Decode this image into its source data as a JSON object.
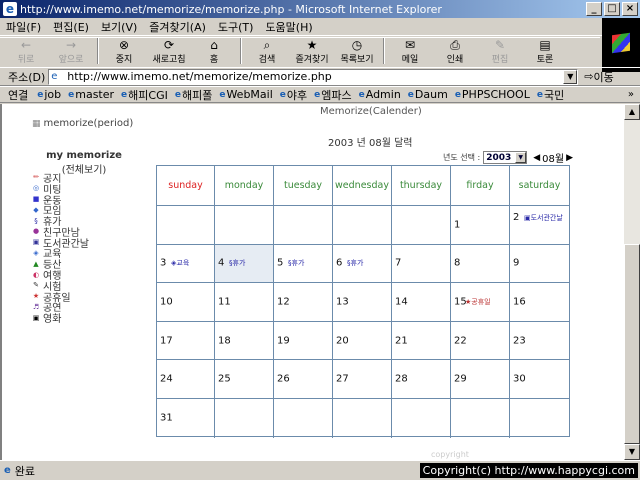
{
  "window": {
    "title": "http://www.imemo.net/memorize/memorize.php - Microsoft Internet Explorer",
    "controls": {
      "minimize": "_",
      "maximize": "□",
      "close": "×"
    }
  },
  "menu": [
    "파일(F)",
    "편집(E)",
    "보기(V)",
    "즐겨찾기(A)",
    "도구(T)",
    "도움말(H)"
  ],
  "toolbar": [
    {
      "label": "뒤로",
      "icon": "←",
      "disabled": true
    },
    {
      "label": "앞으로",
      "icon": "→",
      "disabled": true
    },
    {
      "label": "중지",
      "icon": "⊗",
      "disabled": false
    },
    {
      "label": "새로고침",
      "icon": "⟳",
      "disabled": false
    },
    {
      "label": "홈",
      "icon": "⌂",
      "disabled": false
    },
    {
      "label": "검색",
      "icon": "⌕",
      "disabled": false
    },
    {
      "label": "즐겨찾기",
      "icon": "★",
      "disabled": false
    },
    {
      "label": "목록보기",
      "icon": "◷",
      "disabled": false
    },
    {
      "label": "메일",
      "icon": "✉",
      "disabled": false
    },
    {
      "label": "인쇄",
      "icon": "⎙",
      "disabled": false
    },
    {
      "label": "편집",
      "icon": "✎",
      "disabled": true
    },
    {
      "label": "토론",
      "icon": "▤",
      "disabled": false
    }
  ],
  "address": {
    "label": "주소(D)",
    "value": "http://www.imemo.net/memorize/memorize.php",
    "go": "이동"
  },
  "links": {
    "label": "연결",
    "items": [
      "job",
      "master",
      "해피CGI",
      "해피폴",
      "WebMail",
      "야후",
      "엠파스",
      "Admin",
      "Daum",
      "PHPSCHOOL",
      "국민"
    ],
    "more": "»"
  },
  "sidebar": {
    "header": "memorize(period)",
    "title": "my memorize",
    "view_all": "(전체보기)",
    "categories": [
      {
        "label": "공지",
        "icon": "✏",
        "color": "#cc3333"
      },
      {
        "label": "미팅",
        "icon": "◎",
        "color": "#3366cc"
      },
      {
        "label": "운동",
        "icon": "■",
        "color": "#3333cc"
      },
      {
        "label": "모임",
        "icon": "◆",
        "color": "#3366cc"
      },
      {
        "label": "휴가",
        "icon": "§",
        "color": "#3333aa"
      },
      {
        "label": "친구만남",
        "icon": "●",
        "color": "#993399"
      },
      {
        "label": "도서관간날",
        "icon": "▣",
        "color": "#333399"
      },
      {
        "label": "교육",
        "icon": "◈",
        "color": "#3366cc"
      },
      {
        "label": "등산",
        "icon": "▲",
        "color": "#228822"
      },
      {
        "label": "여행",
        "icon": "◐",
        "color": "#cc3366"
      },
      {
        "label": "시험",
        "icon": "✎",
        "color": "#333333"
      },
      {
        "label": "공휴일",
        "icon": "★",
        "color": "#cc3333"
      },
      {
        "label": "공연",
        "icon": "♬",
        "color": "#663399"
      },
      {
        "label": "영화",
        "icon": "▣",
        "color": "#000000"
      }
    ]
  },
  "calendar": {
    "page_header": "Memorize(Calender)",
    "title": "2003 년 08월 달력",
    "year_label": "년도 선택 :",
    "year": "2003",
    "month": "08월",
    "prev": "◀",
    "next": "▶",
    "weekdays": [
      "sunday",
      "monday",
      "tuesday",
      "wednesday",
      "thursday",
      "firday",
      "saturday"
    ],
    "weeks": [
      [
        {
          "d": ""
        },
        {
          "d": ""
        },
        {
          "d": ""
        },
        {
          "d": ""
        },
        {
          "d": ""
        },
        {
          "d": "1"
        },
        {
          "d": "2",
          "ev": "▣도서관간날",
          "wrap": true
        }
      ],
      [
        {
          "d": "3",
          "ev": "◈교육"
        },
        {
          "d": "4",
          "ev": "§휴가",
          "hl": true
        },
        {
          "d": "5",
          "ev": "§휴가"
        },
        {
          "d": "6",
          "ev": "§휴가"
        },
        {
          "d": "7"
        },
        {
          "d": "8"
        },
        {
          "d": "9"
        }
      ],
      [
        {
          "d": "10"
        },
        {
          "d": "11"
        },
        {
          "d": "12"
        },
        {
          "d": "13"
        },
        {
          "d": "14"
        },
        {
          "d": "15",
          "ev": "★공휴일",
          "red": true
        },
        {
          "d": "16"
        }
      ],
      [
        {
          "d": "17"
        },
        {
          "d": "18"
        },
        {
          "d": "19"
        },
        {
          "d": "20"
        },
        {
          "d": "21"
        },
        {
          "d": "22"
        },
        {
          "d": "23"
        }
      ],
      [
        {
          "d": "24"
        },
        {
          "d": "25"
        },
        {
          "d": "26"
        },
        {
          "d": "27"
        },
        {
          "d": "28"
        },
        {
          "d": "29"
        },
        {
          "d": "30"
        }
      ],
      [
        {
          "d": "31"
        },
        {
          "d": ""
        },
        {
          "d": ""
        },
        {
          "d": ""
        },
        {
          "d": ""
        },
        {
          "d": ""
        },
        {
          "d": ""
        }
      ]
    ],
    "footer": "copyright"
  },
  "status": {
    "text": "완료",
    "copyright": "Copyright(c) http://www.happycgi.com"
  }
}
